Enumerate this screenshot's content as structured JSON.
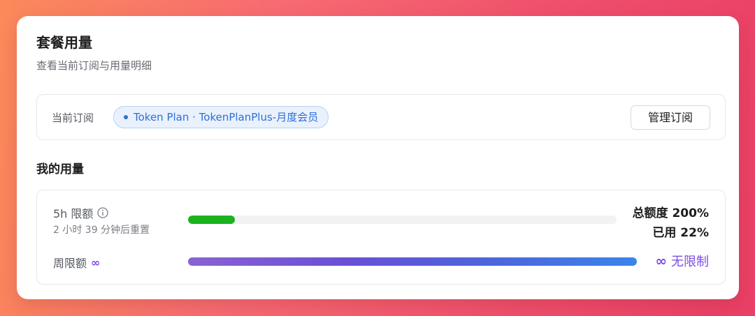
{
  "header": {
    "title": "套餐用量",
    "subtitle": "查看当前订阅与用量明细"
  },
  "subscription": {
    "label": "当前订阅",
    "plan": "Token Plan · TokenPlanPlus-月度会员",
    "manage_label": "管理订阅"
  },
  "usage": {
    "section_title": "我的用量",
    "five_hour": {
      "label": "5h 限额",
      "reset_text": "2 小时 39 分钟后重置",
      "total_text": "总额度 200%",
      "used_text": "已用 22%",
      "progress_fraction": 0.11
    },
    "weekly": {
      "label": "周限额",
      "infinity_symbol": "∞",
      "unlimited_text": "无限制"
    }
  },
  "colors": {
    "accent_blue": "#2f6fd6",
    "progress_green": "#1ab21f",
    "unlimited_purple": "#7c4de0"
  },
  "icons": {
    "info": "info-circle-icon",
    "plan_dot": "dot-icon",
    "infinity": "infinity-icon"
  }
}
